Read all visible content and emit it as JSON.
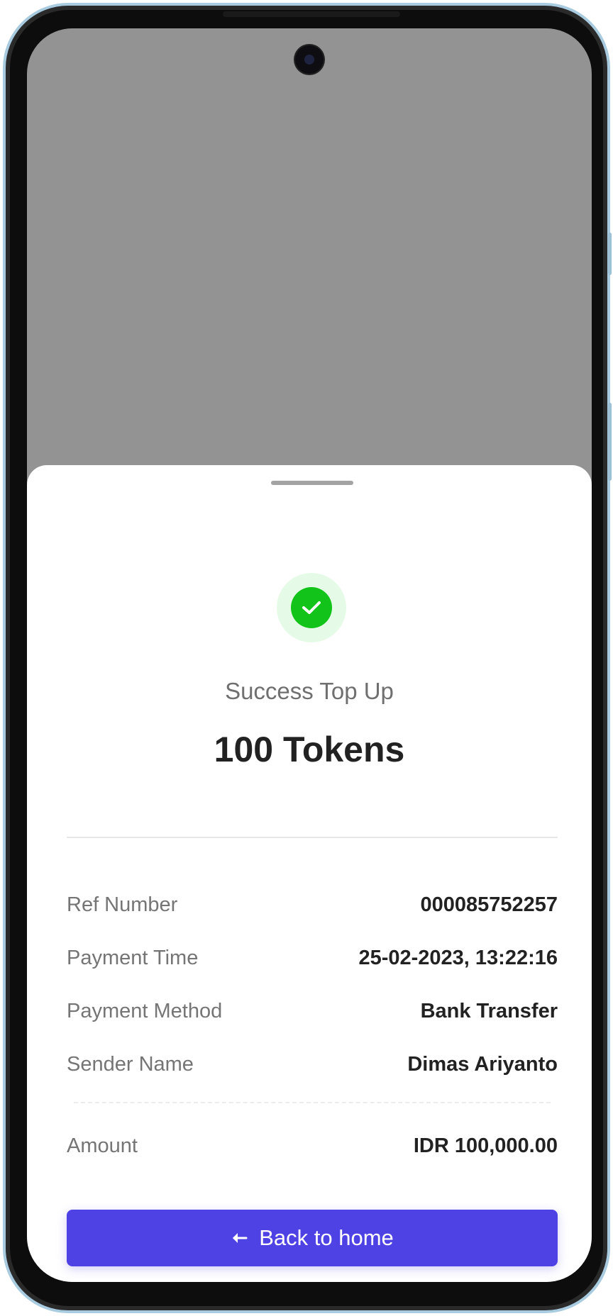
{
  "receipt": {
    "status_text": "Success Top Up",
    "amount_title": "100 Tokens",
    "success_icon": "check-circle",
    "details": [
      {
        "label": "Ref Number",
        "value": "000085752257"
      },
      {
        "label": "Payment Time",
        "value": "25-02-2023, 13:22:16"
      },
      {
        "label": "Payment Method",
        "value": "Bank Transfer"
      },
      {
        "label": "Sender Name",
        "value": "Dimas Ariyanto"
      }
    ],
    "total": {
      "label": "Amount",
      "value": "IDR 100,000.00"
    },
    "back_button": {
      "label": "Back to home",
      "icon": "arrow-left"
    }
  },
  "colors": {
    "accent": "#4f42e4",
    "success": "#12c41a",
    "success_bg": "#e5fbe7",
    "overlay": "#939393"
  }
}
